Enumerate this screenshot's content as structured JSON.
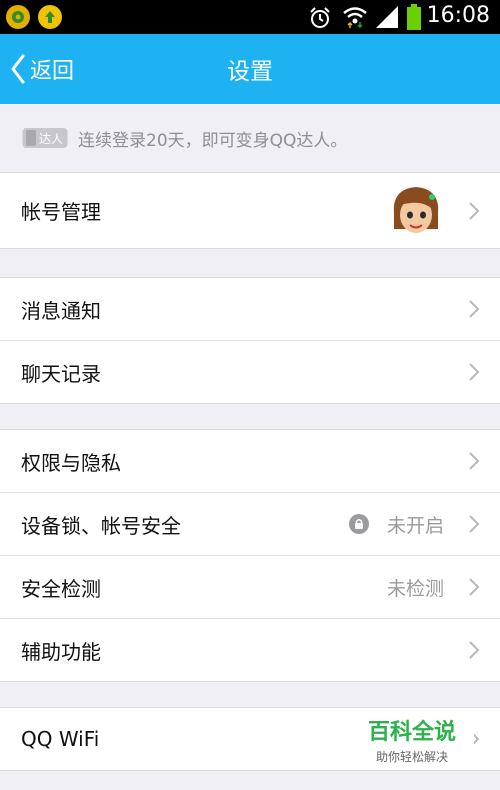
{
  "status_bar": {
    "time": "16:08",
    "icons": [
      "app-icon-1",
      "upload-icon",
      "alarm-icon",
      "wifi-icon",
      "signal-icon",
      "battery-icon"
    ]
  },
  "header": {
    "back_label": "返回",
    "title": "设置",
    "bg_color": "#1fb2f3"
  },
  "tip": {
    "badge_text": "达人",
    "text": "连续登录20天，即可变身QQ达人。"
  },
  "groups": {
    "account": {
      "label": "帐号管理"
    },
    "notify": [
      {
        "label": "消息通知"
      },
      {
        "label": "聊天记录"
      }
    ],
    "security": [
      {
        "label": "权限与隐私"
      },
      {
        "label": "设备锁、帐号安全",
        "value": "未开启"
      },
      {
        "label": "安全检测",
        "value": "未检测"
      },
      {
        "label": "辅助功能"
      }
    ],
    "wifi": {
      "label": "QQ WiFi"
    }
  },
  "watermark": {
    "title": "百科全说",
    "subtitle": "助你轻松解决"
  }
}
